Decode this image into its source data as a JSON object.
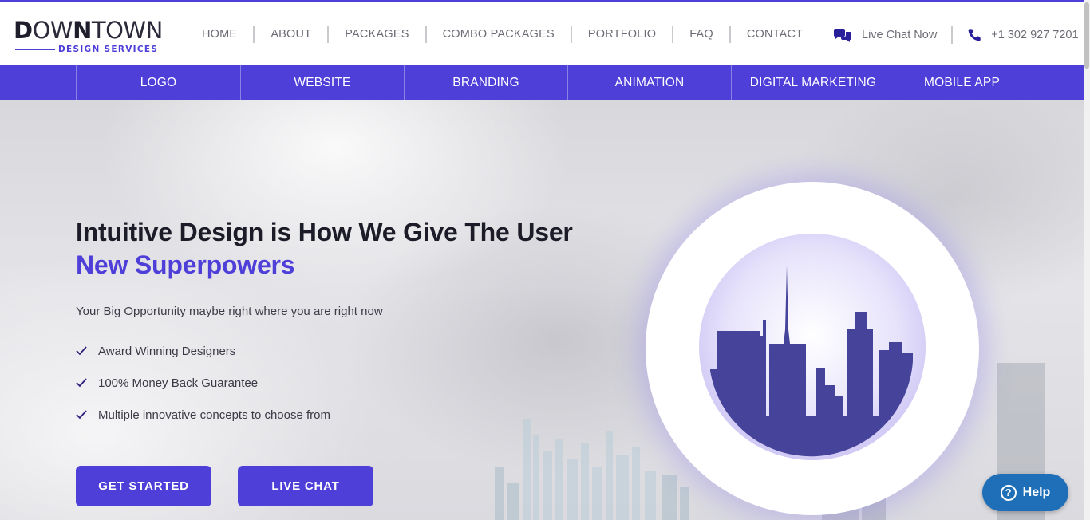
{
  "brand": {
    "name_bold_1": "D",
    "name_light_1": "OW",
    "name_bold_2": "N",
    "name_light_2": "TOWN",
    "subtitle": "DESIGN SERVICES"
  },
  "nav": {
    "items": [
      "HOME",
      "ABOUT",
      "PACKAGES",
      "COMBO PACKAGES",
      "PORTFOLIO",
      "FAQ",
      "CONTACT"
    ]
  },
  "contact": {
    "live_chat_label": "Live Chat Now",
    "live_chat_icon": "chat-bubbles-icon",
    "phone": "+1 302 927 7201",
    "phone_icon": "phone-icon"
  },
  "subnav": {
    "items": [
      "LOGO",
      "WEBSITE",
      "BRANDING",
      "ANIMATION",
      "DIGITAL MARKETING",
      "MOBILE APP"
    ]
  },
  "hero": {
    "title_line1": "Intuitive Design is How We Give The User",
    "title_line2": "New Superpowers",
    "subtitle": "Your Big Opportunity maybe right where you are right now",
    "features": [
      "Award Winning Designers",
      "100% Money Back Guarantee",
      "Multiple innovative concepts to choose from"
    ],
    "primary_button": "GET STARTED",
    "secondary_button": "LIVE CHAT"
  },
  "help_widget": {
    "label": "Help",
    "icon_glyph": "?"
  },
  "colors": {
    "accent": "#4f3fd9",
    "text_dark": "#1c1c28",
    "nav_text": "#6c6c76",
    "help_blue": "#1f6fb8"
  }
}
